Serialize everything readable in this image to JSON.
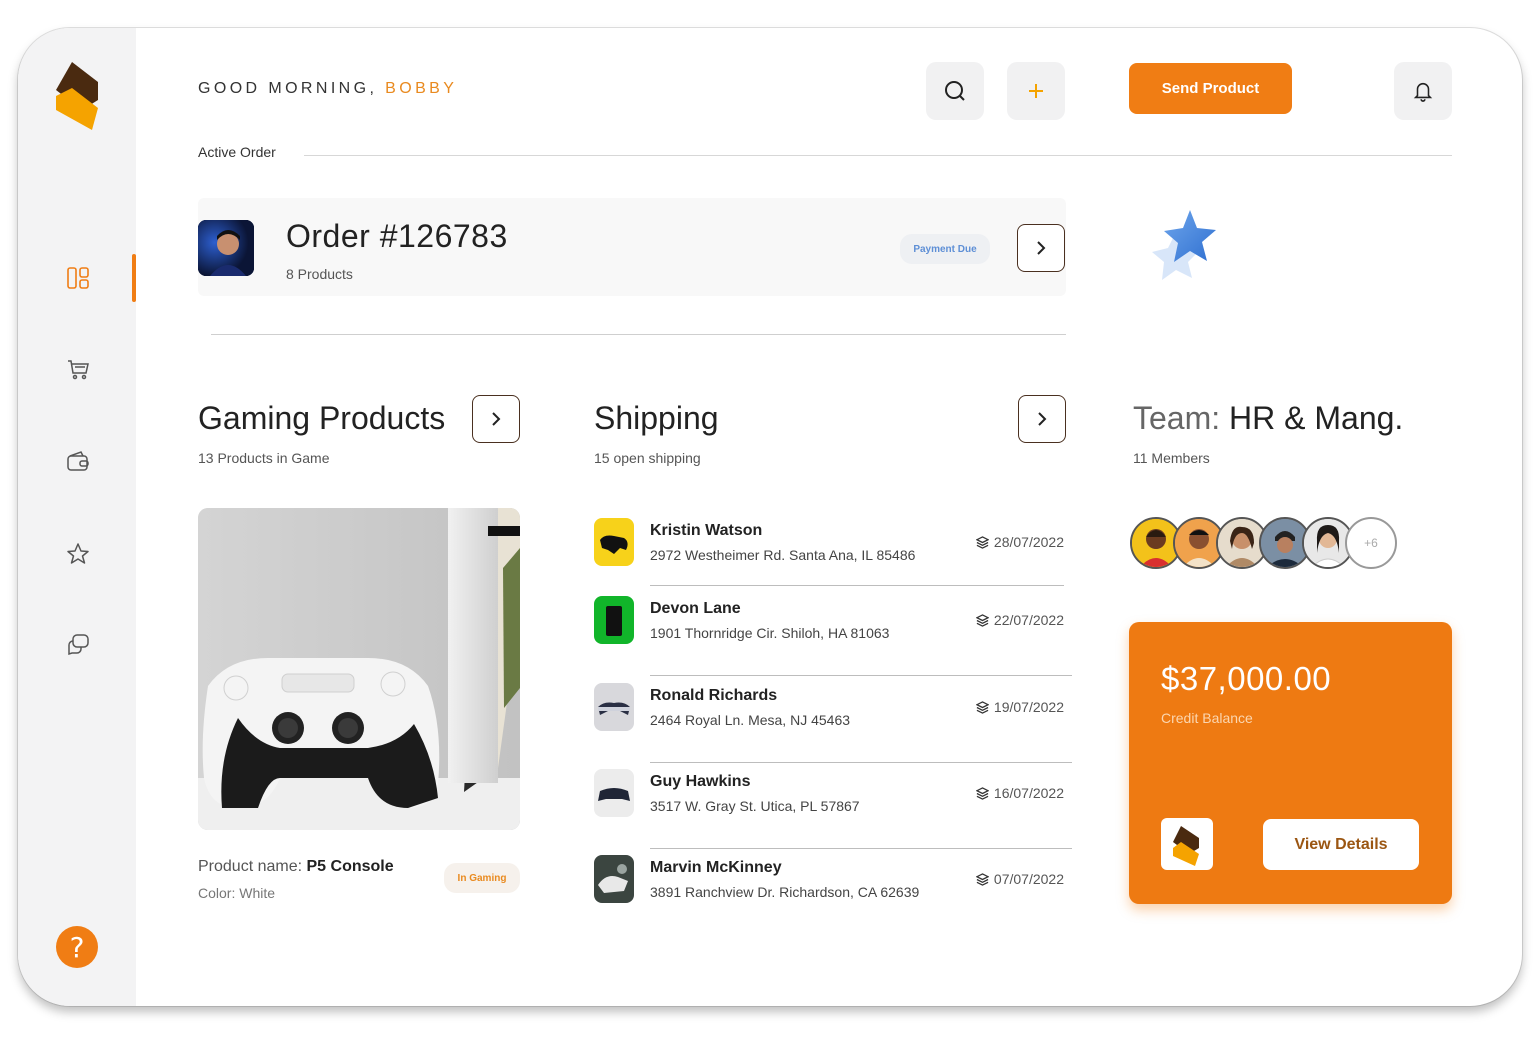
{
  "header": {
    "greeting_prefix": "GOOD MORNING, ",
    "greeting_name": "BOBBY",
    "send_button": "Send Product"
  },
  "active_order": {
    "label": "Active Order",
    "title": "Order #126783",
    "subtitle": "8 Products",
    "status_badge": "Payment Due"
  },
  "gaming": {
    "title": "Gaming Products",
    "subtitle": "13 Products in Game",
    "product_name_label": "Product name: ",
    "product_name": "P5 Console",
    "color_label": "Color: ",
    "color_value": "White",
    "badge": "In Gaming"
  },
  "shipping": {
    "title": "Shipping",
    "subtitle": "15 open shipping",
    "rows": [
      {
        "name": "Kristin Watson",
        "address": "2972 Westheimer Rd. Santa Ana, IL 85486",
        "date": "28/07/2022"
      },
      {
        "name": "Devon Lane",
        "address": "1901 Thornridge Cir. Shiloh, HA 81063",
        "date": "22/07/2022"
      },
      {
        "name": "Ronald Richards",
        "address": "2464 Royal Ln. Mesa, NJ 45463",
        "date": "19/07/2022"
      },
      {
        "name": "Guy Hawkins",
        "address": "3517 W. Gray St. Utica, PL 57867",
        "date": "16/07/2022"
      },
      {
        "name": "Marvin McKinney",
        "address": "3891 Ranchview Dr. Richardson, CA 62639",
        "date": "07/07/2022"
      }
    ]
  },
  "team": {
    "title_prefix": "Team: ",
    "title_name": "HR & Mang.",
    "members": "11 Members",
    "more_count": "+6"
  },
  "credit": {
    "amount": "$37,000.00",
    "label": "Credit Balance",
    "view_button": "View Details"
  },
  "sidebar": {
    "items": [
      "dashboard-icon",
      "cart-icon",
      "wallet-icon",
      "star-icon",
      "chat-icon"
    ],
    "help": "?"
  },
  "colors": {
    "accent": "#f07d14",
    "sidebar_bg": "#f3f3f4",
    "badge_blue": "#5e8fd6"
  }
}
